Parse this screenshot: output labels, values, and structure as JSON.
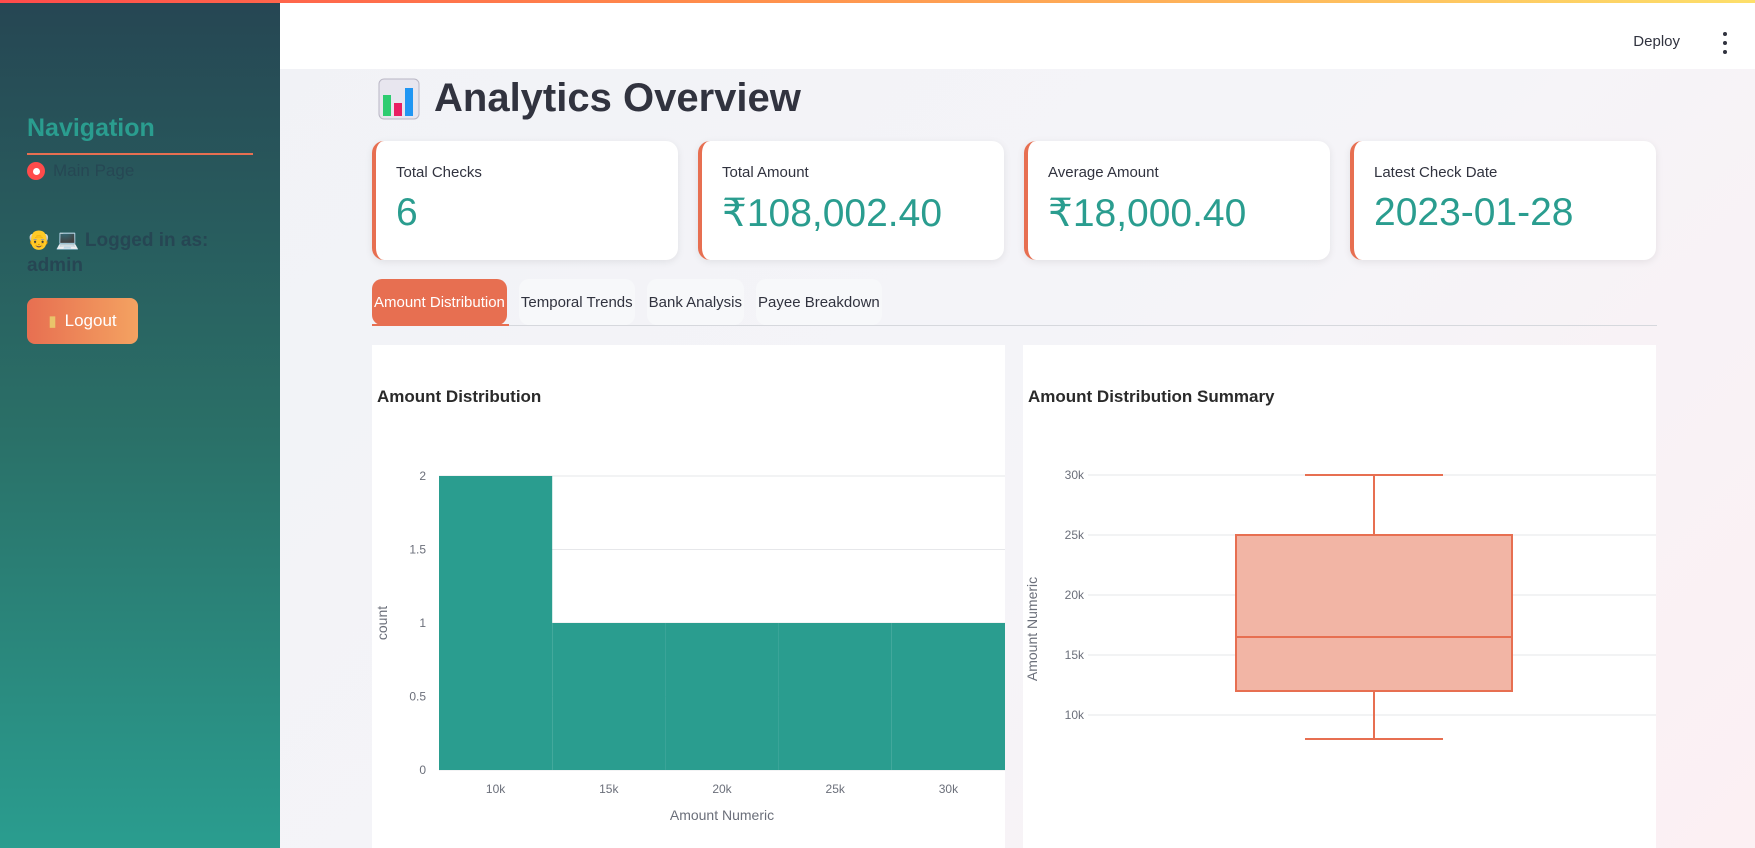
{
  "sidebar": {
    "nav_title": "Navigation",
    "nav_items": [
      {
        "label": "Main Page",
        "selected": true
      }
    ],
    "logged_in_text": "👴 💻 Logged in as: admin",
    "logout_label": "Logout",
    "logout_icon": "door-icon"
  },
  "header": {
    "deploy_label": "Deploy",
    "menu_icon": "vertical-dots-icon"
  },
  "page": {
    "title_icon": "bar-chart-icon",
    "title": "Analytics Overview"
  },
  "metrics": [
    {
      "label": "Total Checks",
      "value": "6"
    },
    {
      "label": "Total Amount",
      "value": "₹108,002.40"
    },
    {
      "label": "Average Amount",
      "value": "₹18,000.40"
    },
    {
      "label": "Latest Check Date",
      "value": "2023-01-28"
    }
  ],
  "tabs": [
    {
      "label": "Amount Distribution",
      "active": true
    },
    {
      "label": "Temporal Trends",
      "active": false
    },
    {
      "label": "Bank Analysis",
      "active": false
    },
    {
      "label": "Payee Breakdown",
      "active": false
    }
  ],
  "colors": {
    "accent": "#e76f51",
    "teal": "#2a9d8f",
    "box_fill": "#f2b5a5",
    "sidebar_top": "#264653"
  },
  "chart_data": [
    {
      "type": "bar",
      "title": "Amount Distribution",
      "xlabel": "Amount Numeric",
      "ylabel": "count",
      "bins": [
        {
          "x0": 7500,
          "x1": 12500,
          "count": 2
        },
        {
          "x0": 12500,
          "x1": 17500,
          "count": 1
        },
        {
          "x0": 17500,
          "x1": 22500,
          "count": 1
        },
        {
          "x0": 22500,
          "x1": 27500,
          "count": 1
        },
        {
          "x0": 27500,
          "x1": 32500,
          "count": 1
        }
      ],
      "xlim": [
        7500,
        32500
      ],
      "ylim": [
        0,
        2
      ],
      "xticks": [
        {
          "v": 10000,
          "label": "10k"
        },
        {
          "v": 15000,
          "label": "15k"
        },
        {
          "v": 20000,
          "label": "20k"
        },
        {
          "v": 25000,
          "label": "25k"
        },
        {
          "v": 30000,
          "label": "30k"
        }
      ],
      "yticks": [
        {
          "v": 0,
          "label": "0"
        },
        {
          "v": 0.5,
          "label": "0.5"
        },
        {
          "v": 1,
          "label": "1"
        },
        {
          "v": 1.5,
          "label": "1.5"
        },
        {
          "v": 2,
          "label": "2"
        }
      ],
      "grid": true,
      "color": "#2a9d8f"
    },
    {
      "type": "box",
      "title": "Amount Distribution Summary",
      "ylabel": "Amount Numeric",
      "min": 8000,
      "q1": 12000,
      "median": 16500,
      "q3": 25000,
      "max": 30000,
      "ylim": [
        6000,
        30000
      ],
      "yticks": [
        {
          "v": 10000,
          "label": "10k"
        },
        {
          "v": 15000,
          "label": "15k"
        },
        {
          "v": 20000,
          "label": "20k"
        },
        {
          "v": 25000,
          "label": "25k"
        },
        {
          "v": 30000,
          "label": "30k"
        }
      ],
      "grid": true,
      "color": "#e76f51"
    }
  ]
}
